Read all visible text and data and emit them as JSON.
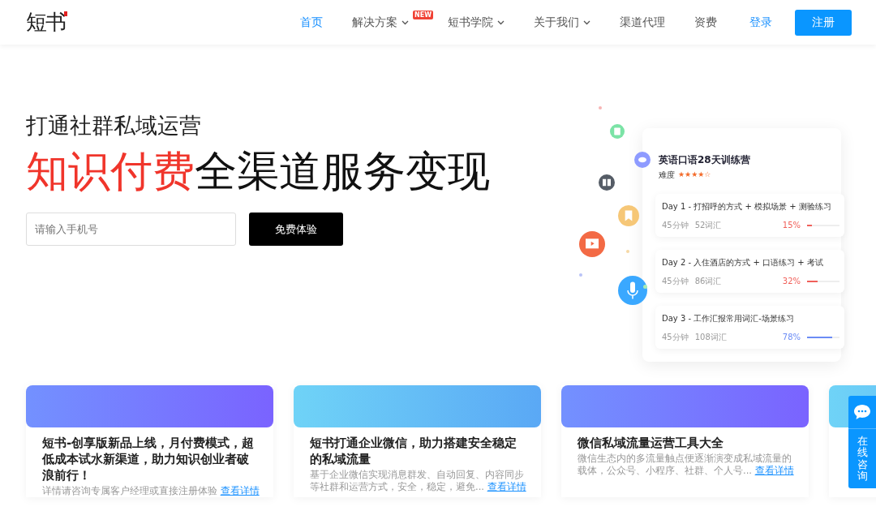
{
  "logo": "短书",
  "nav": [
    {
      "label": "首页",
      "selected": true,
      "dropdown": false
    },
    {
      "label": "解决方案",
      "selected": false,
      "dropdown": true,
      "badge": "NEW"
    },
    {
      "label": "短书学院",
      "selected": false,
      "dropdown": true
    },
    {
      "label": "关于我们",
      "selected": false,
      "dropdown": true
    },
    {
      "label": "渠道代理",
      "selected": false,
      "dropdown": false
    },
    {
      "label": "资费",
      "selected": false,
      "dropdown": false
    }
  ],
  "login": "登录",
  "register": "注册",
  "hero": {
    "subtitle": "打通社群私域运营",
    "title_highlight": "知识付费",
    "title_rest": "全渠道服务变现",
    "phone_placeholder": "请输入手机号",
    "trial_button": "免费体验"
  },
  "course_card": {
    "title": "英语口语28天训练营",
    "difficulty_label": "难度",
    "stars": 4,
    "days": [
      {
        "title": "Day 1 - 打招呼的方式 + 模拟场景 + 测验练习",
        "duration": "45分钟",
        "words": "52词汇",
        "percent": "15%",
        "level": 0.15,
        "color": "#f0605a"
      },
      {
        "title": "Day 2 - 入住酒店的方式 + 口语练习 + 考试",
        "duration": "45分钟",
        "words": "86词汇",
        "percent": "32%",
        "level": 0.32,
        "color": "#f0605a"
      },
      {
        "title": "Day 3 - 工作汇报常用词汇-场景练习",
        "duration": "45分钟",
        "words": "108词汇",
        "percent": "78%",
        "level": 0.78,
        "color": "#6b8cf5"
      }
    ]
  },
  "articles": [
    {
      "kind": "purple",
      "title": "短书-创享版新品上线，月付费模式，超低成本试水新渠道，助力知识创业者破浪前行！",
      "summary": "详情请咨询专属客户经理或直接注册体验",
      "more": "查看详情"
    },
    {
      "kind": "blue",
      "title": "短书打通企业微信，助力搭建安全稳定的私域流量",
      "summary": "基于企业微信实现消息群发、自动回复、内容同步等社群和运营方式，安全，稳定，避免...",
      "more": "查看详情"
    },
    {
      "kind": "purple",
      "title": "微信私域流量运营工具大全",
      "summary": "微信生态内的多流量触点便逐渐演变成私域流量的载体，公众号、小程序、社群、个人号...",
      "more": "查看详情"
    },
    {
      "kind": "blue"
    }
  ],
  "consult": "在线咨询"
}
